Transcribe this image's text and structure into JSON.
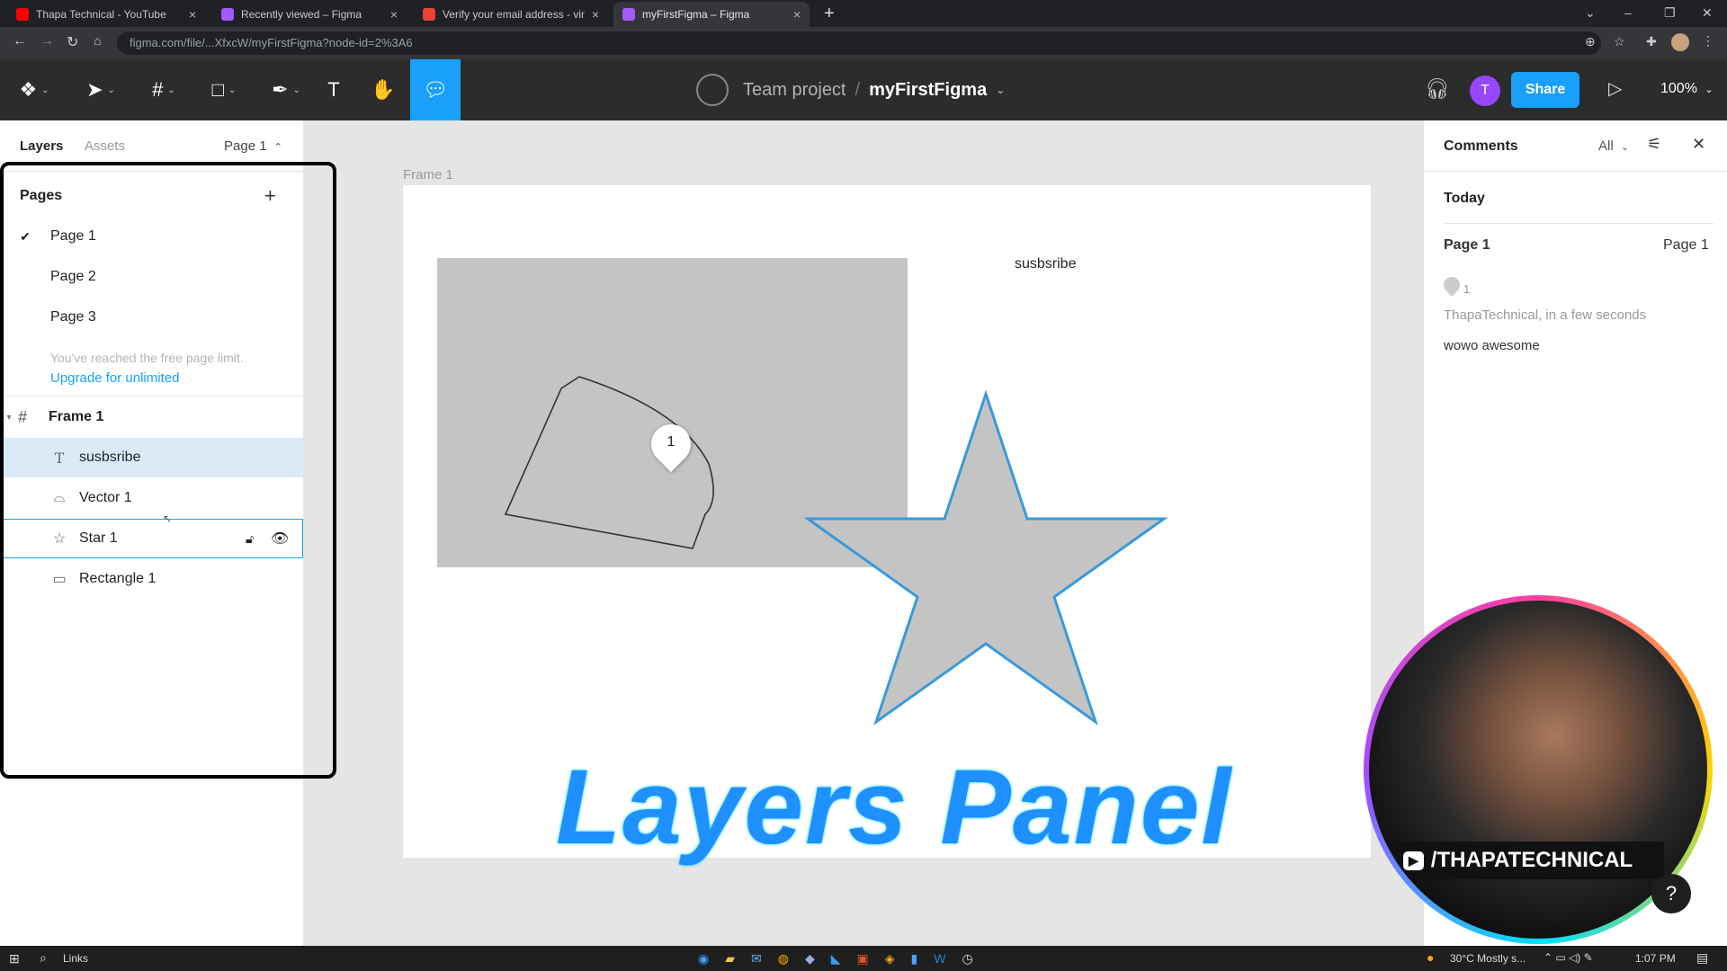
{
  "browser": {
    "tabs": [
      {
        "title": "Thapa Technical - YouTube",
        "color": "#ff0000"
      },
      {
        "title": "Recently viewed – Figma",
        "color": "#a259ff"
      },
      {
        "title": "Verify your email address - vinod",
        "color": "#ea4335"
      },
      {
        "title": "myFirstFigma – Figma",
        "color": "#a259ff"
      }
    ],
    "url": "figma.com/file/...XfxcW/myFirstFigma?node-id=2%3A6"
  },
  "toolbar": {
    "team": "Team project",
    "separator": "/",
    "file": "myFirstFigma",
    "share_label": "Share",
    "avatar_letter": "T",
    "zoom": "100%"
  },
  "left_panel": {
    "tabs": {
      "layers": "Layers",
      "assets": "Assets",
      "page_select": "Page 1"
    },
    "pages_title": "Pages",
    "pages": [
      "Page 1",
      "Page 2",
      "Page 3"
    ],
    "limit_note": "You've reached the free page limit.",
    "upgrade_link": "Upgrade for unlimited",
    "frame_name": "Frame 1",
    "layers": [
      {
        "name": "susbsribe",
        "icon": "text-icon"
      },
      {
        "name": "Vector 1",
        "icon": "vector-icon"
      },
      {
        "name": "Star 1",
        "icon": "star-icon"
      },
      {
        "name": "Rectangle 1",
        "icon": "rectangle-icon"
      }
    ]
  },
  "canvas": {
    "frame_label": "Frame 1",
    "text_node": "susbsribe",
    "comment_pin_number": "1",
    "overlay_title": "Layers Panel"
  },
  "right_panel": {
    "title": "Comments",
    "filter": "All",
    "today": "Today",
    "page_left": "Page 1",
    "page_right": "Page 1",
    "comment_count": "1",
    "comment_author": "ThapaTechnical, in a few seconds",
    "comment_text": "wowo awesome"
  },
  "webcam": {
    "channel": "/THAPATECHNICAL"
  },
  "taskbar": {
    "search_text": "Links",
    "weather": "30°C  Mostly s...",
    "time": "1:07 PM"
  }
}
